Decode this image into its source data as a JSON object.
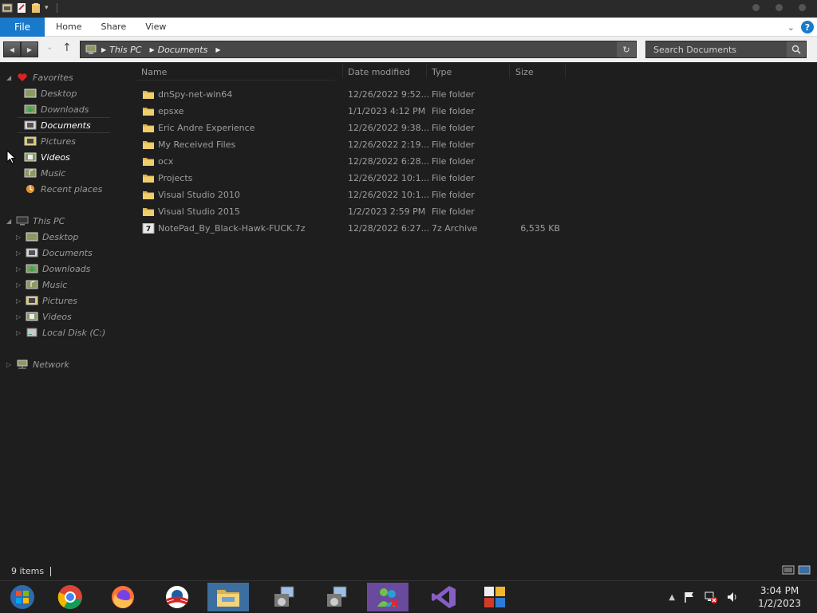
{
  "ribbon": {
    "file_tab": "File",
    "tabs": [
      "Home",
      "Share",
      "View"
    ]
  },
  "address": {
    "crumbs": [
      "This PC",
      "Documents"
    ]
  },
  "search": {
    "placeholder": "Search Documents"
  },
  "nav": {
    "favorites_label": "Favorites",
    "favorites": [
      "Desktop",
      "Downloads",
      "Documents",
      "Pictures",
      "Videos",
      "Music",
      "Recent places"
    ],
    "thispc_label": "This PC",
    "thispc": [
      "Desktop",
      "Documents",
      "Downloads",
      "Music",
      "Pictures",
      "Videos",
      "Local Disk (C:)"
    ],
    "network_label": "Network",
    "selected": "Documents"
  },
  "columns": {
    "name": "Name",
    "date": "Date modified",
    "type": "Type",
    "size": "Size"
  },
  "files": [
    {
      "name": "dnSpy-net-win64",
      "date": "12/26/2022 9:52...",
      "type": "File folder",
      "size": "",
      "icon": "folder-icon"
    },
    {
      "name": "epsxe",
      "date": "1/1/2023 4:12 PM",
      "type": "File folder",
      "size": "",
      "icon": "folder-icon"
    },
    {
      "name": "Eric Andre Experience",
      "date": "12/26/2022 9:38...",
      "type": "File folder",
      "size": "",
      "icon": "folder-icon"
    },
    {
      "name": "My Received Files",
      "date": "12/26/2022 2:19...",
      "type": "File folder",
      "size": "",
      "icon": "folder-icon"
    },
    {
      "name": "ocx",
      "date": "12/28/2022 6:28...",
      "type": "File folder",
      "size": "",
      "icon": "folder-icon"
    },
    {
      "name": "Projects",
      "date": "12/26/2022 10:1...",
      "type": "File folder",
      "size": "",
      "icon": "folder-icon"
    },
    {
      "name": "Visual Studio 2010",
      "date": "12/26/2022 10:1...",
      "type": "File folder",
      "size": "",
      "icon": "folder-icon"
    },
    {
      "name": "Visual Studio 2015",
      "date": "1/2/2023 2:59 PM",
      "type": "File folder",
      "size": "",
      "icon": "folder-icon"
    },
    {
      "name": "NotePad_By_Black-Hawk-FUCK.7z",
      "date": "12/28/2022 6:27...",
      "type": "7z Archive",
      "size": "6,535 KB",
      "icon": "archive-7z-icon"
    }
  ],
  "status": {
    "count": "9 items"
  },
  "taskbar": {
    "apps": [
      "start-icon",
      "chrome-icon",
      "firefox-icon",
      "obama-icon",
      "file-explorer-icon",
      "installer-icon",
      "installer-icon",
      "messenger-icon",
      "visual-studio-icon",
      "office-icon"
    ],
    "time": "3:04 PM",
    "date": "1/2/2023"
  }
}
